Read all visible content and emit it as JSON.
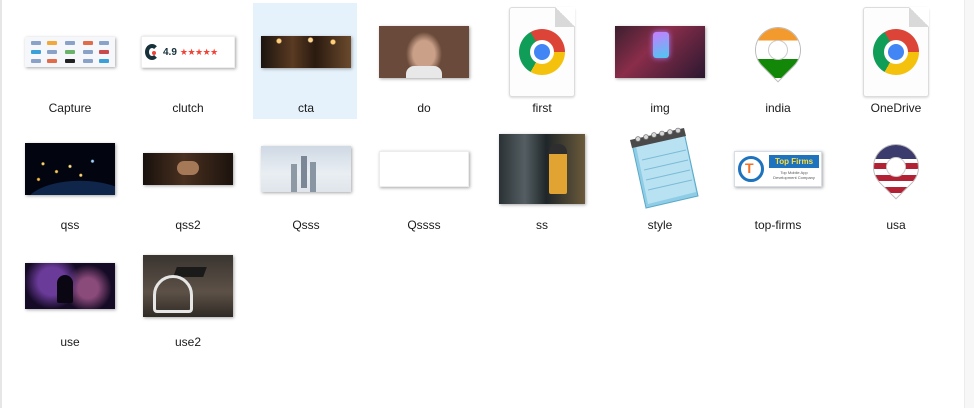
{
  "files": [
    {
      "name": "Capture",
      "icon": "image-thumbnail"
    },
    {
      "name": "clutch",
      "icon": "image-thumbnail",
      "badge": {
        "rating": "4.9",
        "stars": "★★★★★"
      }
    },
    {
      "name": "cta",
      "icon": "image-thumbnail",
      "selected": true
    },
    {
      "name": "do",
      "icon": "image-thumbnail"
    },
    {
      "name": "first",
      "icon": "chrome-html-icon"
    },
    {
      "name": "img",
      "icon": "image-thumbnail"
    },
    {
      "name": "india",
      "icon": "india-flag-pin-icon"
    },
    {
      "name": "OneDrive",
      "icon": "chrome-html-icon"
    },
    {
      "name": "qss",
      "icon": "image-thumbnail"
    },
    {
      "name": "qss2",
      "icon": "image-thumbnail"
    },
    {
      "name": "Qsss",
      "icon": "image-thumbnail"
    },
    {
      "name": "Qssss",
      "icon": "image-thumbnail"
    },
    {
      "name": "ss",
      "icon": "image-thumbnail"
    },
    {
      "name": "style",
      "icon": "notepad-icon"
    },
    {
      "name": "top-firms",
      "icon": "image-thumbnail",
      "badge": {
        "title": "Top Firms",
        "subtitle": "Top Mobile App Development Company"
      }
    },
    {
      "name": "usa",
      "icon": "usa-flag-pin-icon"
    },
    {
      "name": "use",
      "icon": "image-thumbnail"
    },
    {
      "name": "use2",
      "icon": "image-thumbnail"
    }
  ],
  "colors": {
    "selection": "#e5f1fb",
    "label_text": "#1a1a1a",
    "background": "#ffffff"
  }
}
